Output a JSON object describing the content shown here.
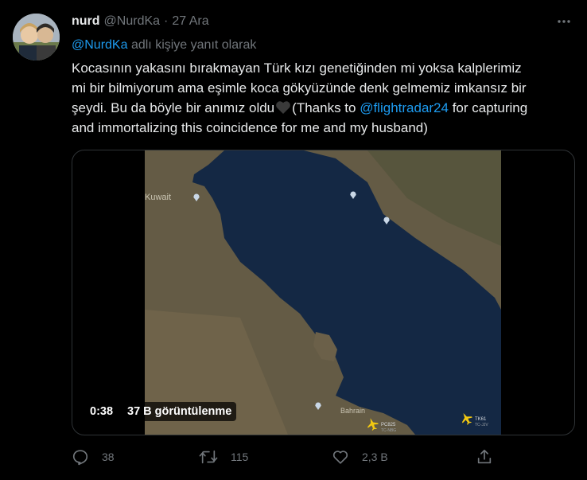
{
  "tweet": {
    "author_name": "nurd",
    "author_handle": "@NurdKa",
    "separator": "·",
    "date": "27 Ara",
    "reply_mention": "@NurdKa",
    "reply_suffix": " adlı kişiye yanıt olarak",
    "text_line1": "Kocasının yakasını bırakmayan Türk kızı genetiğinden mi yoksa kalplerimiz",
    "text_line2": "mi bir bilmiyorum ama eşimle  koca gökyüzünde denk gelmemiz imkansız bir",
    "text_line3_start": "şeydi. Bu da böyle bir anımız oldu",
    "text_line3_mid": "(Thanks to ",
    "text_line3_link": "@flightradar24",
    "text_line3_end": " for capturing",
    "text_line4": "and immortalizing this coincidence for me and my husband)"
  },
  "video": {
    "duration": "0:38",
    "views": "37 B görüntülenme",
    "map_labels": {
      "kuwait": "Kuwait",
      "bahrain": "Bahrain",
      "flight1_code": "PC825",
      "flight1_sub": "TC-NBG",
      "flight2_code": "TK61",
      "flight2_sub": "TC-JJV"
    }
  },
  "actions": {
    "replies": "38",
    "retweets": "115",
    "likes": "2,3 B"
  },
  "colors": {
    "background": "#000000",
    "text": "#e7e9ea",
    "secondary": "#71767b",
    "accent": "#1d9bf0",
    "border": "#2f3336"
  },
  "icons": [
    "more-icon",
    "heart-icon",
    "reply-icon",
    "retweet-icon",
    "like-icon",
    "share-icon",
    "plane-icon",
    "map-pin-icon"
  ]
}
